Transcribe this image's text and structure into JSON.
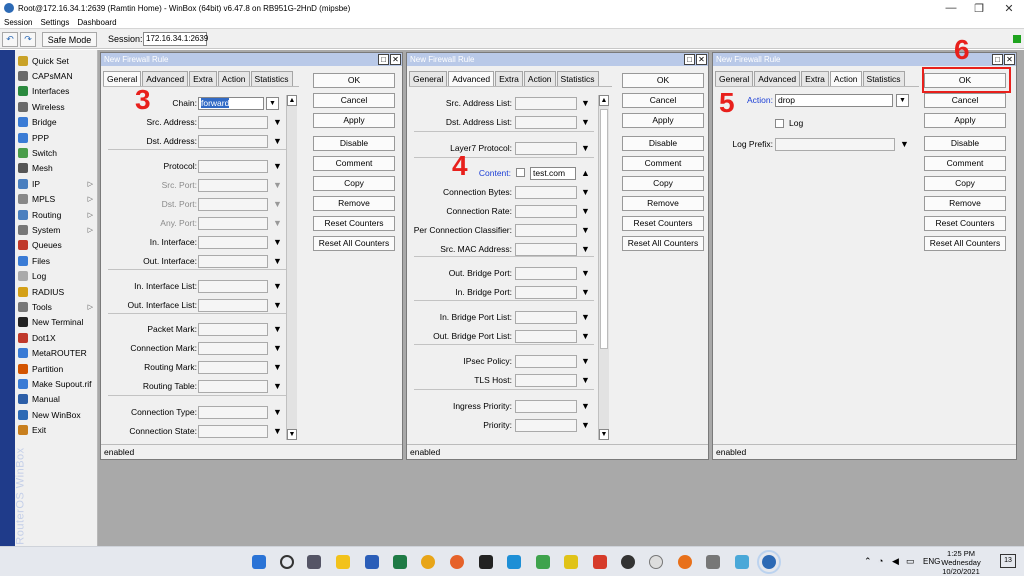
{
  "window": {
    "title": "Root@172.16.34.1:2639 (Ramtin Home) - WinBox (64bit) v6.47.8 on RB951G-2HnD (mipsbe)",
    "minimize": "—",
    "maximize": "❐",
    "close": "✕"
  },
  "menu": [
    "Session",
    "Settings",
    "Dashboard"
  ],
  "toolbar": {
    "undo": "↶",
    "redo": "↷",
    "safe_mode": "Safe Mode",
    "session_label": "Session:",
    "session_value": "172.16.34.1:2639"
  },
  "sidebar": {
    "brand": "RouterOS WinBox",
    "items": [
      {
        "label": "Quick Set",
        "icon": "wrench-icon",
        "color": "#c9a227"
      },
      {
        "label": "CAPsMAN",
        "icon": "antenna-icon",
        "color": "#6a6a6a"
      },
      {
        "label": "Interfaces",
        "icon": "interfaces-icon",
        "color": "#2b8a3e"
      },
      {
        "label": "Wireless",
        "icon": "wireless-icon",
        "color": "#6a6a6a"
      },
      {
        "label": "Bridge",
        "icon": "bridge-icon",
        "color": "#3a7bd5"
      },
      {
        "label": "PPP",
        "icon": "ppp-icon",
        "color": "#3a7bd5"
      },
      {
        "label": "Switch",
        "icon": "switch-icon",
        "color": "#4a9d4a"
      },
      {
        "label": "Mesh",
        "icon": "mesh-icon",
        "color": "#555"
      },
      {
        "label": "IP",
        "icon": "ip-icon",
        "color": "#4a7fbf",
        "sub": true
      },
      {
        "label": "MPLS",
        "icon": "mpls-icon",
        "color": "#888",
        "sub": true
      },
      {
        "label": "Routing",
        "icon": "routing-icon",
        "color": "#4a7fbf",
        "sub": true
      },
      {
        "label": "System",
        "icon": "system-icon",
        "color": "#777",
        "sub": true
      },
      {
        "label": "Queues",
        "icon": "queues-icon",
        "color": "#c0392b"
      },
      {
        "label": "Files",
        "icon": "files-icon",
        "color": "#3a7bd5"
      },
      {
        "label": "Log",
        "icon": "log-icon",
        "color": "#aaa"
      },
      {
        "label": "RADIUS",
        "icon": "radius-icon",
        "color": "#d4a017"
      },
      {
        "label": "Tools",
        "icon": "tools-icon",
        "color": "#777",
        "sub": true
      },
      {
        "label": "New Terminal",
        "icon": "terminal-icon",
        "color": "#222"
      },
      {
        "label": "Dot1X",
        "icon": "dot1x-icon",
        "color": "#c0392b"
      },
      {
        "label": "MetaROUTER",
        "icon": "metarouter-icon",
        "color": "#3a7bd5"
      },
      {
        "label": "Partition",
        "icon": "partition-icon",
        "color": "#d35400"
      },
      {
        "label": "Make Supout.rif",
        "icon": "supout-icon",
        "color": "#3a7bd5"
      },
      {
        "label": "Manual",
        "icon": "manual-icon",
        "color": "#2d5fa8"
      },
      {
        "label": "New WinBox",
        "icon": "winbox-icon",
        "color": "#2d6ab5"
      },
      {
        "label": "Exit",
        "icon": "exit-icon",
        "color": "#c87f1e"
      }
    ]
  },
  "dialog_title": "New Firewall Rule",
  "tabs": {
    "general": [
      "General",
      "Advanced",
      "Extra",
      "Action",
      "Statistics"
    ],
    "advanced": [
      "General",
      "Advanced",
      "Extra",
      "Action",
      "Statistics"
    ],
    "action": [
      "General",
      "Advanced",
      "Extra",
      "Action",
      "Statistics"
    ]
  },
  "buttons": [
    "OK",
    "Cancel",
    "Apply",
    "Disable",
    "Comment",
    "Copy",
    "Remove",
    "Reset Counters",
    "Reset All Counters"
  ],
  "general_form": {
    "chain_label": "Chain:",
    "chain_value": "forward",
    "fields": [
      "Src. Address:",
      "Dst. Address:",
      "Protocol:",
      "Src. Port:",
      "Dst. Port:",
      "Any. Port:",
      "In. Interface:",
      "Out. Interface:",
      "In. Interface List:",
      "Out. Interface List:",
      "Packet Mark:",
      "Connection Mark:",
      "Routing Mark:",
      "Routing Table:",
      "Connection Type:",
      "Connection State:"
    ]
  },
  "advanced_form": {
    "fields": [
      "Src. Address List:",
      "Dst. Address List:",
      "Layer7 Protocol:",
      "Connection Bytes:",
      "Connection Rate:",
      "Per Connection Classifier:",
      "Src. MAC Address:",
      "Out. Bridge Port:",
      "In. Bridge Port:",
      "In. Bridge Port List:",
      "Out. Bridge Port List:",
      "IPsec Policy:",
      "TLS Host:",
      "Ingress Priority:",
      "Priority:"
    ],
    "content_label": "Content:",
    "content_value": "test.com"
  },
  "action_form": {
    "action_label": "Action:",
    "action_value": "drop",
    "log_label": "Log",
    "log_prefix_label": "Log Prefix:"
  },
  "status": "enabled",
  "steps": {
    "s3": "3",
    "s4": "4",
    "s5": "5",
    "s6": "6"
  },
  "clock": {
    "time": "1:25 PM",
    "day": "Wednesday",
    "date": "10/20/2021"
  },
  "tray": {
    "lang": "ENG",
    "notif": "13"
  }
}
